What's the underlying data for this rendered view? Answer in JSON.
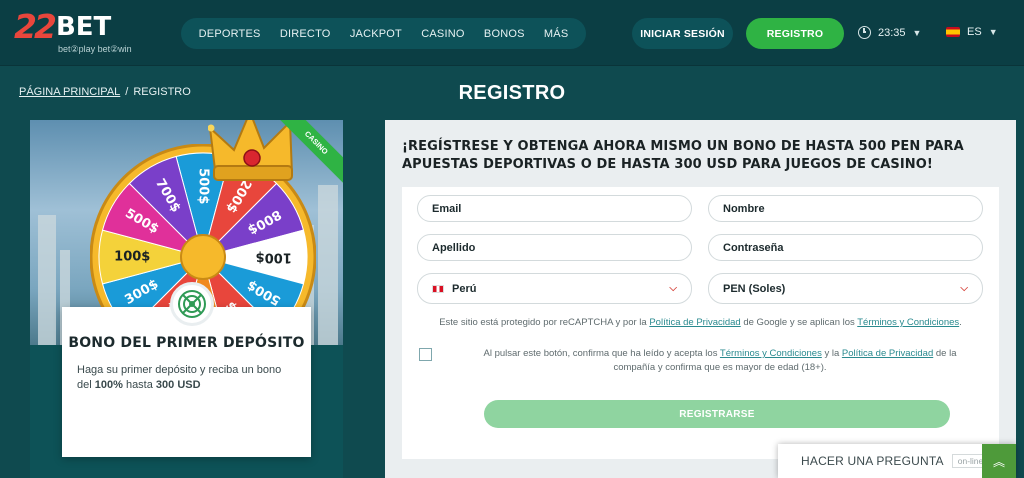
{
  "header": {
    "logo_num": "22",
    "logo_word": "BET",
    "logo_tag": "bet②play bet②win",
    "nav": [
      "DEPORTES",
      "DIRECTO",
      "JACKPOT",
      "CASINO",
      "BONOS",
      "MÁS"
    ],
    "login_label": "INICIAR SESIÓN",
    "register_label": "REGISTRO",
    "time": "23:35",
    "lang": "ES"
  },
  "breadcrumb": {
    "home": "PÁGINA PRINCIPAL",
    "sep": "/",
    "current": "REGISTRO"
  },
  "page_title": "REGISTRO",
  "promo": {
    "ribbon": "CASINO",
    "wheel_segments": [
      "500$",
      "200$",
      "800$",
      "100$",
      "500$",
      "200$",
      "500$",
      "800$",
      "300$",
      "100$",
      "500$",
      "700$"
    ],
    "title": "BONO DEL PRIMER DEPÓSITO",
    "desc_pre": "Haga su primer depósito y reciba un bono del ",
    "desc_pct": "100%",
    "desc_mid": " hasta ",
    "desc_amt": "300 USD"
  },
  "form": {
    "heading": "¡REGÍSTRESE Y OBTENGA AHORA MISMO UN BONO DE HASTA 500 PEN PARA APUESTAS DEPORTIVAS O DE HASTA 300 USD PARA JUEGOS DE CASINO!",
    "email": "Email",
    "name": "Nombre",
    "surname": "Apellido",
    "password": "Contraseña",
    "country": "Perú",
    "currency": "PEN (Soles)",
    "captcha_pre": "Este sitio está protegido por reCAPTCHA y por la ",
    "captcha_link1": "Política de Privacidad",
    "captcha_mid": " de Google y se aplican los ",
    "captcha_link2": "Términos y Condiciones",
    "captcha_post": ".",
    "terms_pre": "Al pulsar este botón, confirma que ha leído y acepta los ",
    "terms_link1": "Términos y Condiciones",
    "terms_mid": " y la ",
    "terms_link2": "Política de Privacidad",
    "terms_post": " de la compañía y confirma que es mayor de edad (18+).",
    "submit": "REGISTRARSE"
  },
  "chat": {
    "label": "HACER UNA PREGUNTA",
    "status": "on-line"
  },
  "colors": {
    "bg": "#0f4a4f",
    "accent_green": "#2fb344",
    "submit_disabled": "#8fd4a0",
    "link": "#2a8a8f"
  }
}
